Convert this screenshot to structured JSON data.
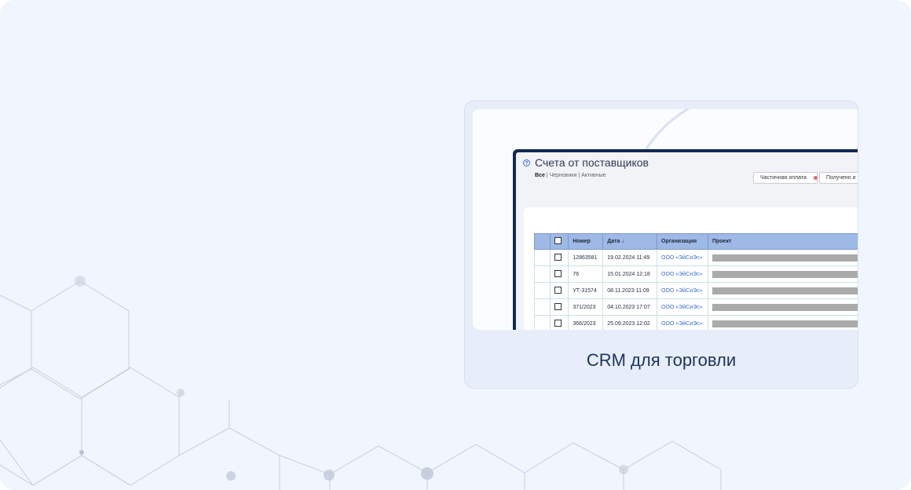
{
  "app": {
    "title": "Счета от поставщиков",
    "filters": {
      "all": "Все",
      "drafts": "Черновики",
      "active": "Активные",
      "separator": " | "
    },
    "buttons": {
      "partial_payment": "Частичная оплата",
      "received": "Получено и"
    },
    "status_dot_color": "#e46b67",
    "help_icon": "question-circle-icon"
  },
  "table": {
    "columns": [
      "",
      "",
      "Номер",
      "Дата ↓",
      "Организация",
      "Проект"
    ],
    "rows": [
      {
        "number": "12863581",
        "date": "19.02.2024 11:49",
        "org": "ООО «ЭйСиЭс»"
      },
      {
        "number": "76",
        "date": "15.01.2024 12:18",
        "org": "ООО «ЭйСиЭс»"
      },
      {
        "number": "УТ-31574",
        "date": "08.11.2023 11:09",
        "org": "ООО «ЭйСиЭс»"
      },
      {
        "number": "371/2023",
        "date": "04.10.2023 17:07",
        "org": "ООО «ЭйСиЭс»"
      },
      {
        "number": "366/2023",
        "date": "25.09.2023 12:02",
        "org": "ООО «ЭйСиЭс»"
      }
    ]
  },
  "card": {
    "caption": "CRM для торговли"
  },
  "colors": {
    "background": "#f1f5fd",
    "card": "#e7eefa",
    "accent": "#1d3461",
    "header_row": "#9fb9e6"
  }
}
